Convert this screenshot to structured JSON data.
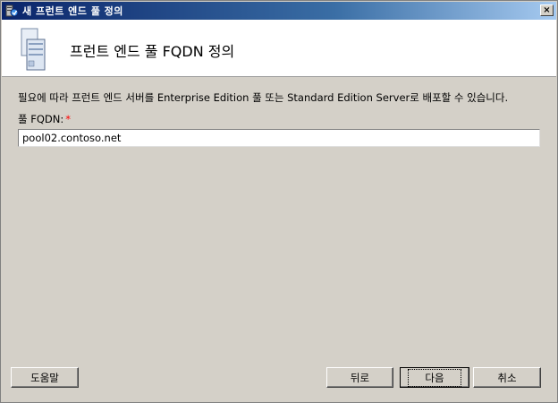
{
  "window": {
    "title": "새 프런트 엔드 풀 정의",
    "close_label": "×"
  },
  "header": {
    "title": "프런트 엔드 풀 FQDN 정의"
  },
  "main": {
    "description": "필요에 따라 프런트 엔드 서버를 Enterprise Edition 풀 또는 Standard Edition Server로 배포할 수 있습니다.",
    "fqdn_label": "풀 FQDN:",
    "required_marker": "*",
    "fqdn_value": "pool02.contoso.net"
  },
  "buttons": {
    "help": "도움말",
    "back": "뒤로",
    "next": "다음",
    "cancel": "취소"
  },
  "colors": {
    "title_bar": "#0a246a",
    "dialog_bg": "#d4d0c8",
    "required": "#ff0000"
  },
  "icons": {
    "title": "server-wizard-icon",
    "header": "server-stack-icon"
  }
}
